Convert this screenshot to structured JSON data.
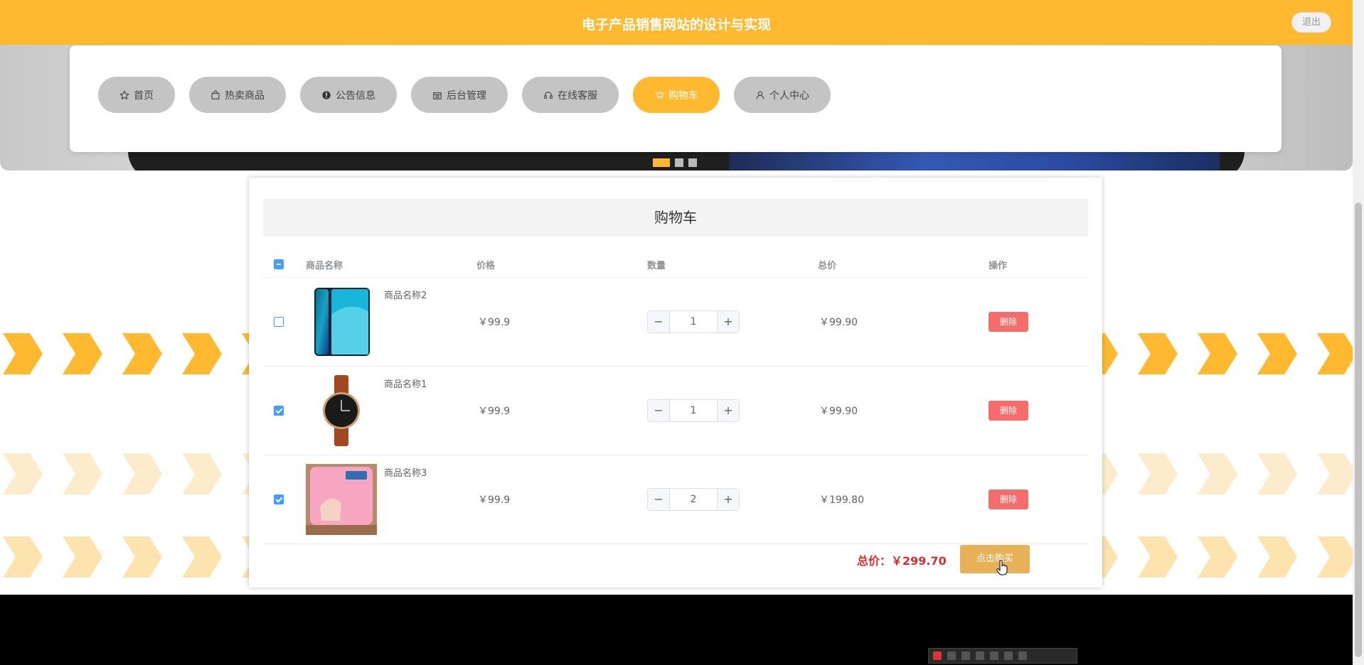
{
  "header": {
    "title": "电子产品销售网站的设计与实现",
    "logout_label": "退出"
  },
  "nav": {
    "items": [
      {
        "label": "首页",
        "icon": "star-icon"
      },
      {
        "label": "热卖商品",
        "icon": "bag-icon"
      },
      {
        "label": "公告信息",
        "icon": "info-icon"
      },
      {
        "label": "后台管理",
        "icon": "store-icon"
      },
      {
        "label": "在线客服",
        "icon": "headset-icon"
      },
      {
        "label": "购物车",
        "icon": "cart-icon",
        "active": true
      },
      {
        "label": "个人中心",
        "icon": "user-icon"
      }
    ]
  },
  "cart": {
    "title": "购物车",
    "columns": {
      "name": "商品名称",
      "price": "价格",
      "qty": "数量",
      "subtotal": "总价",
      "action": "操作"
    },
    "rows": [
      {
        "name": "商品名称2",
        "price": "￥99.9",
        "qty": "1",
        "subtotal": "￥99.90",
        "delete_label": "删除",
        "checked": false
      },
      {
        "name": "商品名称1",
        "price": "￥99.9",
        "qty": "1",
        "subtotal": "￥99.90",
        "delete_label": "删除",
        "checked": true
      },
      {
        "name": "商品名称3",
        "price": "￥99.9",
        "qty": "2",
        "subtotal": "￥199.80",
        "delete_label": "删除",
        "checked": true
      }
    ],
    "step_minus": "−",
    "step_plus": "+",
    "total_label": "总价：",
    "total_value": "￥299.70",
    "buy_label": "点击购买"
  },
  "colors": {
    "accent": "#ffb930",
    "danger": "#f56c6c",
    "checkbox": "#409eff",
    "total_text": "#d32f2f"
  }
}
